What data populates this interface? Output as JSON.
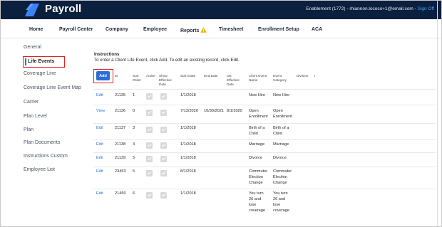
{
  "app": {
    "name": "Payroll",
    "account": "Enablement (1772) - rhiannon.lococo+1@email.com - ",
    "signoff": "Sign Off"
  },
  "menu": [
    "Home",
    "Payroll Center",
    "Company",
    "Employee",
    "Reports",
    "Timesheet",
    "Enrollment Setup",
    "ACA"
  ],
  "sidebar": [
    "General",
    "Life Events",
    "Coverage Line",
    "Coverage Line Event Map",
    "Carrier",
    "Plan Level",
    "Plan",
    "Plan Documents",
    "Instructions Custom",
    "Employee List"
  ],
  "instructions": {
    "title": "Instructions",
    "text": "To enter a Client Life Event, click Add. To edit an existing record, click Edit."
  },
  "table": {
    "add_label": "Add",
    "headers": {
      "id": "ID",
      "sort": "Sort Order",
      "active": "Active",
      "show_eff": "Show Effective Date",
      "start": "Start Date",
      "end": "End Date",
      "oe_eff": "OE Effective Date",
      "client_event": "Client Event Name",
      "event_cat": "Event Category",
      "division": "Division"
    },
    "rows": [
      {
        "action": "Edit",
        "id": "21135",
        "sort": "1",
        "start": "1/1/2018",
        "end": "",
        "oe": "",
        "name": "New Hire",
        "cat": "New Hire"
      },
      {
        "action": "View",
        "id": "21136",
        "sort": "0",
        "start": "7/13/2020",
        "end": "10/30/2021",
        "oe": "8/1/2020",
        "name": "Open Enrollment",
        "cat": "Open Enrollment"
      },
      {
        "action": "Edit",
        "id": "21137",
        "sort": "3",
        "start": "1/1/2018",
        "end": "",
        "oe": "",
        "name": "Birth of a Child",
        "cat": "Birth of a Child"
      },
      {
        "action": "Edit",
        "id": "21138",
        "sort": "4",
        "start": "1/1/2018",
        "end": "",
        "oe": "",
        "name": "Marriage",
        "cat": "Marriage"
      },
      {
        "action": "Edit",
        "id": "21139",
        "sort": "5",
        "start": "1/1/2018",
        "end": "",
        "oe": "",
        "name": "Divorce",
        "cat": "Divorce"
      },
      {
        "action": "Edit",
        "id": "23453",
        "sort": "5",
        "start": "8/1/2018",
        "end": "",
        "oe": "",
        "name": "Commuter Election Change",
        "cat": "Commuter Election Change"
      },
      {
        "action": "Edit",
        "id": "21450",
        "sort": "6",
        "start": "1/1/2018",
        "end": "",
        "oe": "",
        "name": "You turn 26 and lose coverage",
        "cat": "You turn 26 and lose coverage"
      }
    ]
  },
  "colors": {
    "topbar": "#0b1f3f",
    "accent": "#2a6ed6",
    "highlight": "#e02020",
    "warning": "#f5b301"
  }
}
